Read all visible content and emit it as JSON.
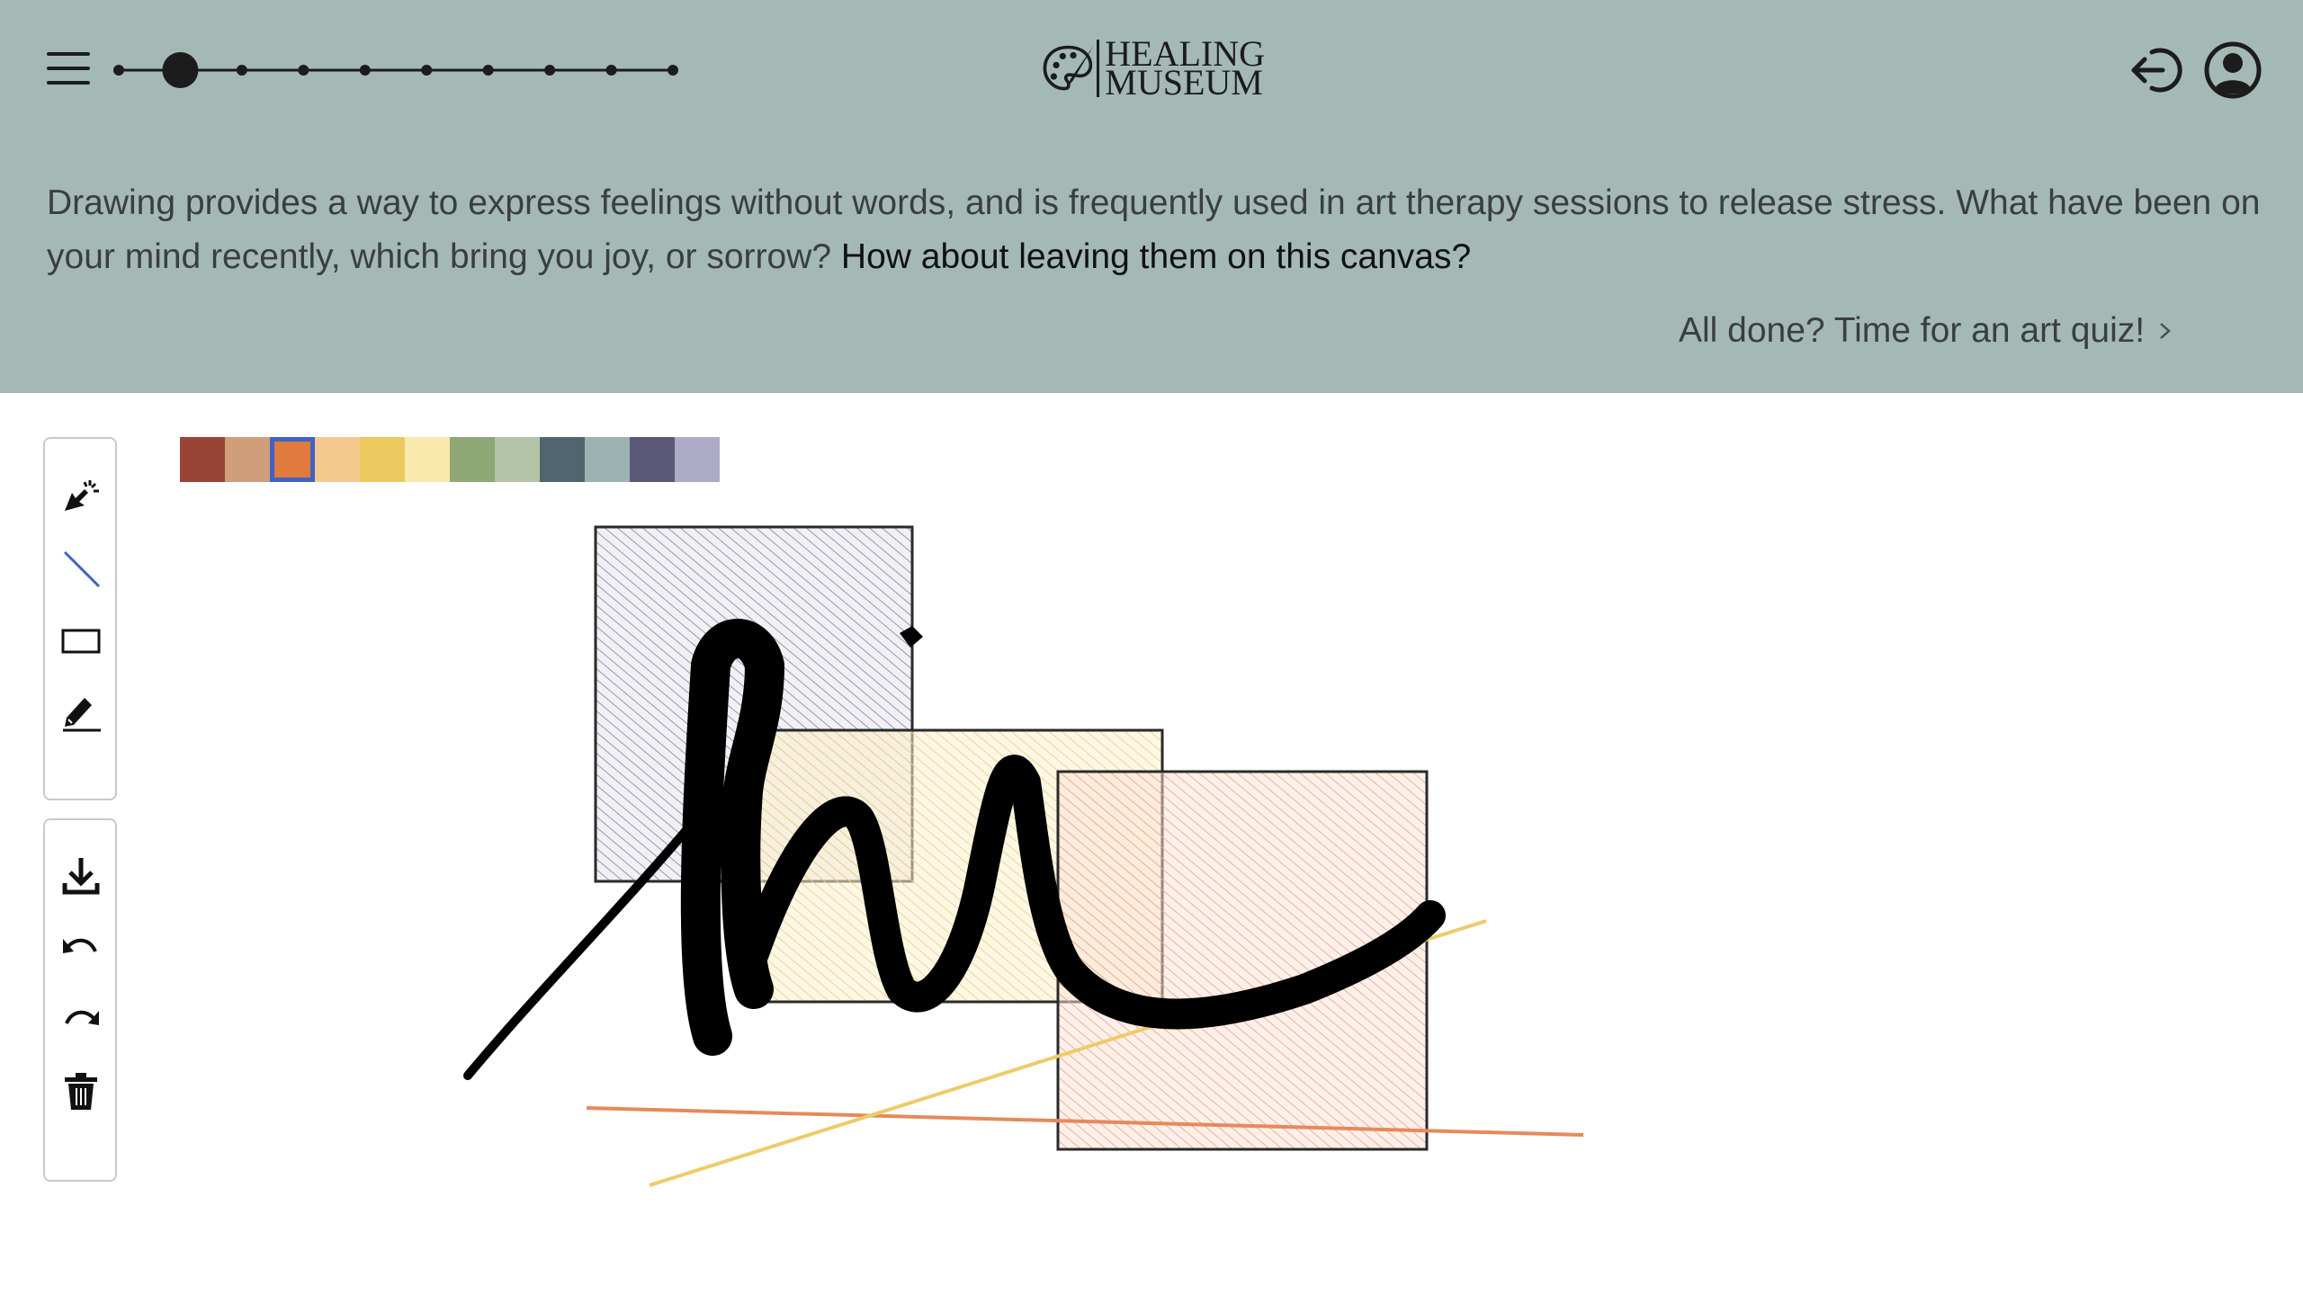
{
  "header": {
    "logo": {
      "line1": "HEALING",
      "line2": "MUSEUM",
      "icon": "palette-icon"
    },
    "menu_icon": "hamburger-icon",
    "exit_icon": "logout-icon",
    "account_icon": "user-circle-icon",
    "progress": {
      "total_steps": 10,
      "current_step": 2
    }
  },
  "intro": {
    "text": "Drawing provides a way to express feelings without words, and is frequently used in art therapy sessions to release stress. What have been on your mind recently, which bring you joy, or sorrow?",
    "question": "How about leaving them on this canvas?"
  },
  "quiz_link": {
    "label": "All done? Time for an art quiz!",
    "icon": "chevron-right-icon"
  },
  "tools": [
    {
      "name": "select",
      "icon": "cursor-sparkle-icon"
    },
    {
      "name": "line",
      "icon": "line-icon"
    },
    {
      "name": "rectangle",
      "icon": "rectangle-icon"
    },
    {
      "name": "pencil",
      "icon": "pencil-icon"
    }
  ],
  "actions": [
    {
      "name": "download",
      "icon": "download-icon"
    },
    {
      "name": "undo",
      "icon": "undo-icon"
    },
    {
      "name": "redo",
      "icon": "redo-icon"
    },
    {
      "name": "clear",
      "icon": "trash-icon"
    }
  ],
  "palette": {
    "colors": [
      "#9a4438",
      "#d09e7a",
      "#e07a3f",
      "#f5c98e",
      "#ecc95e",
      "#fbe8ad",
      "#8da775",
      "#b3c4a6",
      "#4f6570",
      "#9bb3b0",
      "#5b5878",
      "#aeabc7"
    ],
    "selected_index": 2
  },
  "colors": {
    "header_bg": "#a4b9b5",
    "accent_selection": "#3f63c4",
    "stroke": "#000000"
  }
}
